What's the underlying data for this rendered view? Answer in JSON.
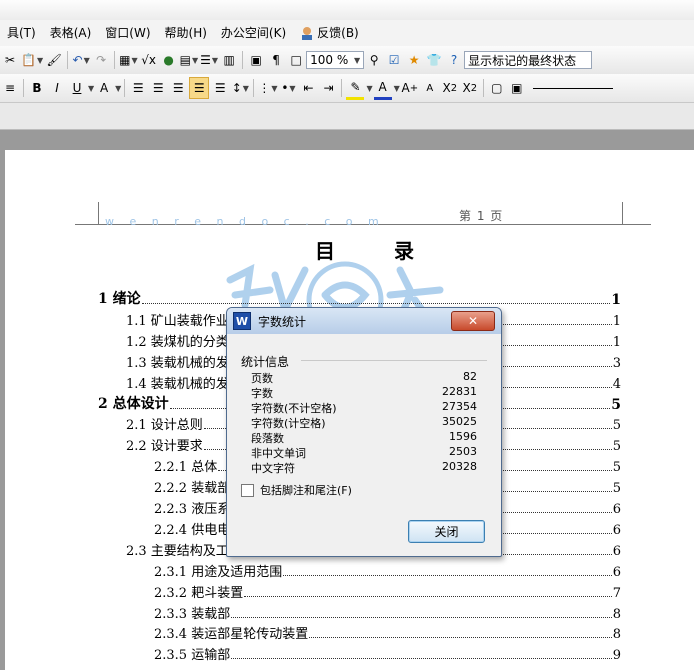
{
  "menus": [
    "具(T)",
    "表格(A)",
    "窗口(W)",
    "帮助(H)",
    "办公空间(K)",
    "反馈(B)"
  ],
  "toolbar": {
    "zoom": "100 %",
    "markup_mode": "显示标记的最终状态",
    "format_buttons": [
      "B",
      "I",
      "U",
      "A"
    ]
  },
  "page": {
    "header_page": "第 1 页",
    "toc_title": "目 录",
    "watermark_url": "w e n r e n d o c . c o m",
    "toc": [
      {
        "level": 1,
        "title": "1 绪论",
        "page": "1"
      },
      {
        "level": 2,
        "title": "1.1 矿山装载作业",
        "page": "1"
      },
      {
        "level": 2,
        "title": "1.2 装煤机的分类",
        "page": "1"
      },
      {
        "level": 2,
        "title": "1.3 装载机械的发",
        "page": "3"
      },
      {
        "level": 2,
        "title": "1.4 装载机械的发",
        "page": "4"
      },
      {
        "level": 1,
        "title": "2 总体设计",
        "page": "5"
      },
      {
        "level": 2,
        "title": "2.1 设计总则",
        "page": "5"
      },
      {
        "level": 2,
        "title": "2.2 设计要求",
        "page": "5"
      },
      {
        "level": 3,
        "title": "2.2.1 总体",
        "page": "5"
      },
      {
        "level": 3,
        "title": "2.2.2 装载部",
        "page": "5"
      },
      {
        "level": 3,
        "title": "2.2.3 液压系",
        "page": "6"
      },
      {
        "level": 3,
        "title": "2.2.4 供电电",
        "page": "6"
      },
      {
        "level": 2,
        "title": "2.3 主要结构及工",
        "page": "6"
      },
      {
        "level": 3,
        "title": "2.3.1 用途及适用范围",
        "page": "6"
      },
      {
        "level": 3,
        "title": "2.3.2 耙斗装置",
        "page": "7"
      },
      {
        "level": 3,
        "title": "2.3.3 装载部",
        "page": "8"
      },
      {
        "level": 3,
        "title": "2.3.4 装运部星轮传动装置",
        "page": "8"
      },
      {
        "level": 3,
        "title": "2.3.5 运输部",
        "page": "9"
      }
    ]
  },
  "dialog": {
    "title": "字数统计",
    "icon": "W",
    "group_label": "统计信息",
    "stats": [
      {
        "label": "页数",
        "value": "82"
      },
      {
        "label": "字数",
        "value": "22831"
      },
      {
        "label": "字符数(不计空格)",
        "value": "27354"
      },
      {
        "label": "字符数(计空格)",
        "value": "35025"
      },
      {
        "label": "段落数",
        "value": "1596"
      },
      {
        "label": "非中文单词",
        "value": "2503"
      },
      {
        "label": "中文字符",
        "value": "20328"
      }
    ],
    "checkbox_label": "包括脚注和尾注(F)",
    "checkbox_checked": false,
    "close_button": "关闭"
  }
}
